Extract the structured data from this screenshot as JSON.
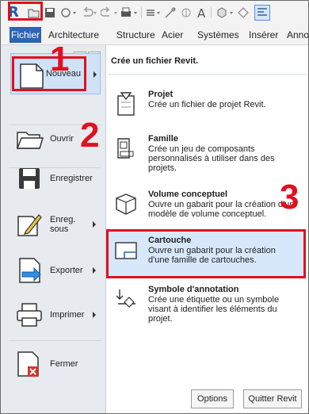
{
  "ribbon": {
    "tabs": [
      "Fichier",
      "Architecture",
      "Structure",
      "Acier",
      "Systèmes",
      "Insérer",
      "Annot"
    ]
  },
  "menu": {
    "items": [
      {
        "label": "Nouveau",
        "has_submenu": true
      },
      {
        "label": "Ouvrir",
        "has_submenu": false
      },
      {
        "label": "Enregistrer",
        "has_submenu": false
      },
      {
        "label": "Enreg.\nsous",
        "has_submenu": true
      },
      {
        "label": "Exporter",
        "has_submenu": true
      },
      {
        "label": "Imprimer",
        "has_submenu": true
      },
      {
        "label": "Fermer",
        "has_submenu": false
      }
    ]
  },
  "panel": {
    "title": "Crée un fichier Revit.",
    "entries": [
      {
        "title": "Projet",
        "desc": "Crée un fichier de projet Revit."
      },
      {
        "title": "Famille",
        "desc": "Crée un jeu de composants personnalisés à utiliser dans des projets."
      },
      {
        "title": "Volume conceptuel",
        "desc": "Ouvre un gabarit pour la création d'un modèle de volume conceptuel."
      },
      {
        "title": "Cartouche",
        "desc": "Ouvre un gabarit pour la création d'une famille de cartouches."
      },
      {
        "title": "Symbole d'annotation",
        "desc": "Crée une étiquette ou un symbole visant à identifier les éléments du projet."
      }
    ]
  },
  "buttons": {
    "options": "Options",
    "quit": "Quitter Revit"
  },
  "steps": [
    "1",
    "2",
    "3"
  ],
  "colors": {
    "accent": "#2d64b3",
    "highlight": "#e1101e",
    "selected": "#d7e8fb"
  }
}
